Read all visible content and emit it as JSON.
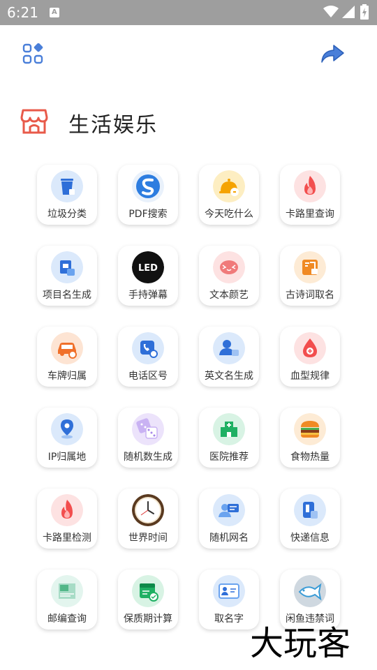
{
  "status_bar": {
    "time": "6:21",
    "notif_letter": "A"
  },
  "section": {
    "title": "生活娱乐"
  },
  "tools": [
    {
      "label": "垃圾分类",
      "icon": "trash-icon"
    },
    {
      "label": "PDF搜索",
      "icon": "pdf-search-icon"
    },
    {
      "label": "今天吃什么",
      "icon": "food-bell-icon"
    },
    {
      "label": "卡路里查询",
      "icon": "flame-icon"
    },
    {
      "label": "项目名生成",
      "icon": "project-name-icon"
    },
    {
      "label": "手持弹幕",
      "icon": "led-icon"
    },
    {
      "label": "文本颜艺",
      "icon": "emoji-face-icon"
    },
    {
      "label": "古诗词取名",
      "icon": "poem-icon"
    },
    {
      "label": "车牌归属",
      "icon": "car-plate-icon"
    },
    {
      "label": "电话区号",
      "icon": "phone-icon"
    },
    {
      "label": "英文名生成",
      "icon": "english-name-icon"
    },
    {
      "label": "血型规律",
      "icon": "blood-drop-icon"
    },
    {
      "label": "IP归属地",
      "icon": "location-pin-icon"
    },
    {
      "label": "随机数生成",
      "icon": "dice-icon"
    },
    {
      "label": "医院推荐",
      "icon": "hospital-icon"
    },
    {
      "label": "食物热量",
      "icon": "burger-icon"
    },
    {
      "label": "卡路里检测",
      "icon": "flame-check-icon"
    },
    {
      "label": "世界时间",
      "icon": "clock-icon"
    },
    {
      "label": "随机网名",
      "icon": "nickname-icon"
    },
    {
      "label": "快递信息",
      "icon": "delivery-icon"
    },
    {
      "label": "邮编查询",
      "icon": "postcode-icon"
    },
    {
      "label": "保质期计算",
      "icon": "calendar-check-icon"
    },
    {
      "label": "取名字",
      "icon": "id-card-icon"
    },
    {
      "label": "闲鱼违禁词",
      "icon": "fish-icon"
    }
  ],
  "watermark": "大玩客"
}
